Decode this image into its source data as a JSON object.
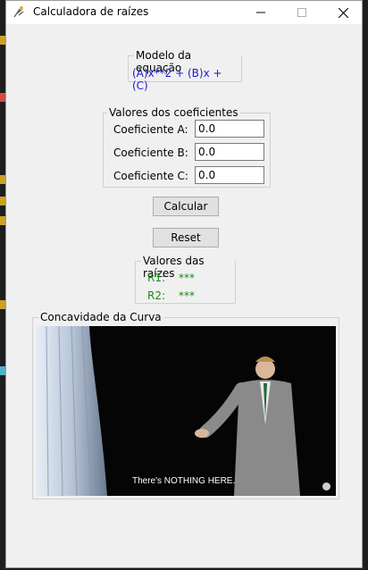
{
  "window": {
    "title": "Calculadora de raízes",
    "controls": {
      "minimize": "—",
      "maximize": "☐",
      "close": "✕"
    }
  },
  "model": {
    "legend": "Modelo da equação",
    "equation": "(A)x**2 + (B)x + (C)"
  },
  "coefficients": {
    "legend": "Valores dos coeficientes",
    "a_label": "Coeficiente A:",
    "b_label": "Coeficiente B:",
    "c_label": "Coeficiente C:",
    "a_value": "0.0",
    "b_value": "0.0",
    "c_value": "0.0"
  },
  "actions": {
    "calculate_label": "Calcular",
    "reset_label": "Reset"
  },
  "roots": {
    "legend": "Valores das raízes",
    "r1_label": "R1:",
    "r2_label": "R2:",
    "r1_value": "***",
    "r2_value": "***"
  },
  "curve": {
    "legend": "Concavidade da Curva",
    "image_caption": "There's NOTHING HERE."
  },
  "colors": {
    "equation": "#1a1ad2",
    "root_values": "#1a8a1a"
  }
}
